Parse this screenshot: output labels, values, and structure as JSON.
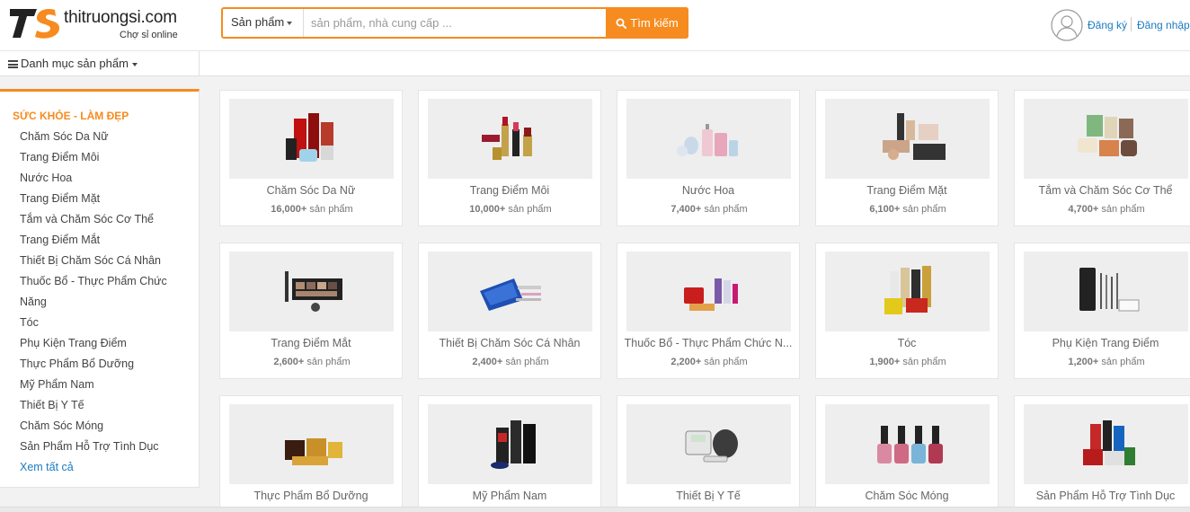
{
  "brand": {
    "mark": "TS",
    "name": "thitruongsi.com",
    "tagline": "Chợ sỉ online",
    "accent_color": "#f68b1f",
    "link_color": "#1a7bc0"
  },
  "search": {
    "category_label": "Sản phẩm",
    "placeholder": "sản phẩm, nhà cung cấp ...",
    "value": "",
    "button_label": "Tìm kiếm",
    "button_icon": "search-icon"
  },
  "user": {
    "avatar_icon": "user-avatar-icon",
    "register_label": "Đăng ký",
    "login_label": "Đăng nhập"
  },
  "nav": {
    "categories_toggle_label": "Danh mục sản phẩm",
    "toggle_icon": "menu-bars-icon"
  },
  "sidebar": {
    "title": "SỨC KHỎE - LÀM ĐẸP",
    "items": [
      "Chăm Sóc Da Nữ",
      "Trang Điểm Môi",
      "Nước Hoa",
      "Trang Điểm Mặt",
      "Tắm và Chăm Sóc Cơ Thể",
      "Trang Điểm Mắt",
      "Thiết Bị Chăm Sóc Cá Nhân",
      "Thuốc Bổ - Thực Phẩm Chức",
      "Năng",
      "Tóc",
      "Phụ Kiện Trang Điểm",
      "Thực Phẩm Bổ Dưỡng",
      "Mỹ Phẩm Nam",
      "Thiết Bị Y Tế",
      "Chăm Sóc Móng",
      "Sản Phẩm Hỗ Trợ Tình Dục"
    ],
    "more_label": "Xem tất cả"
  },
  "categories": [
    {
      "name": "Chăm Sóc Da Nữ",
      "count": "16,000+",
      "unit": "sản phẩm",
      "icon": "skincare-products-image"
    },
    {
      "name": "Trang Điểm Môi",
      "count": "10,000+",
      "unit": "sản phẩm",
      "icon": "lipstick-products-image"
    },
    {
      "name": "Nước Hoa",
      "count": "7,400+",
      "unit": "sản phẩm",
      "icon": "perfume-bottles-image"
    },
    {
      "name": "Trang Điểm Mặt",
      "count": "6,100+",
      "unit": "sản phẩm",
      "icon": "face-makeup-image"
    },
    {
      "name": "Tắm và Chăm Sóc Cơ Thể",
      "count": "4,700+",
      "unit": "sản phẩm",
      "icon": "body-care-image"
    },
    {
      "name": "Trang Điểm Mắt",
      "count": "2,600+",
      "unit": "sản phẩm",
      "icon": "eye-makeup-image"
    },
    {
      "name": "Thiết Bị Chăm Sóc Cá Nhân",
      "count": "2,400+",
      "unit": "sản phẩm",
      "icon": "personal-care-device-image"
    },
    {
      "name": "Thuốc Bổ - Thực Phẩm Chức N...",
      "count": "2,200+",
      "unit": "sản phẩm",
      "icon": "supplements-image"
    },
    {
      "name": "Tóc",
      "count": "1,900+",
      "unit": "sản phẩm",
      "icon": "hair-care-image"
    },
    {
      "name": "Phụ Kiện Trang Điểm",
      "count": "1,200+",
      "unit": "sản phẩm",
      "icon": "makeup-brushes-image"
    },
    {
      "name": "Thực Phẩm Bổ Dưỡng",
      "count": "",
      "unit": "",
      "icon": "nutrition-food-image"
    },
    {
      "name": "Mỹ Phẩm Nam",
      "count": "",
      "unit": "",
      "icon": "men-cosmetics-image"
    },
    {
      "name": "Thiết Bị Y Tế",
      "count": "",
      "unit": "",
      "icon": "medical-device-image"
    },
    {
      "name": "Chăm Sóc Móng",
      "count": "",
      "unit": "",
      "icon": "nail-polish-image"
    },
    {
      "name": "Sản Phẩm Hỗ Trợ Tình Dục",
      "count": "",
      "unit": "",
      "icon": "sexual-health-products-image"
    }
  ]
}
